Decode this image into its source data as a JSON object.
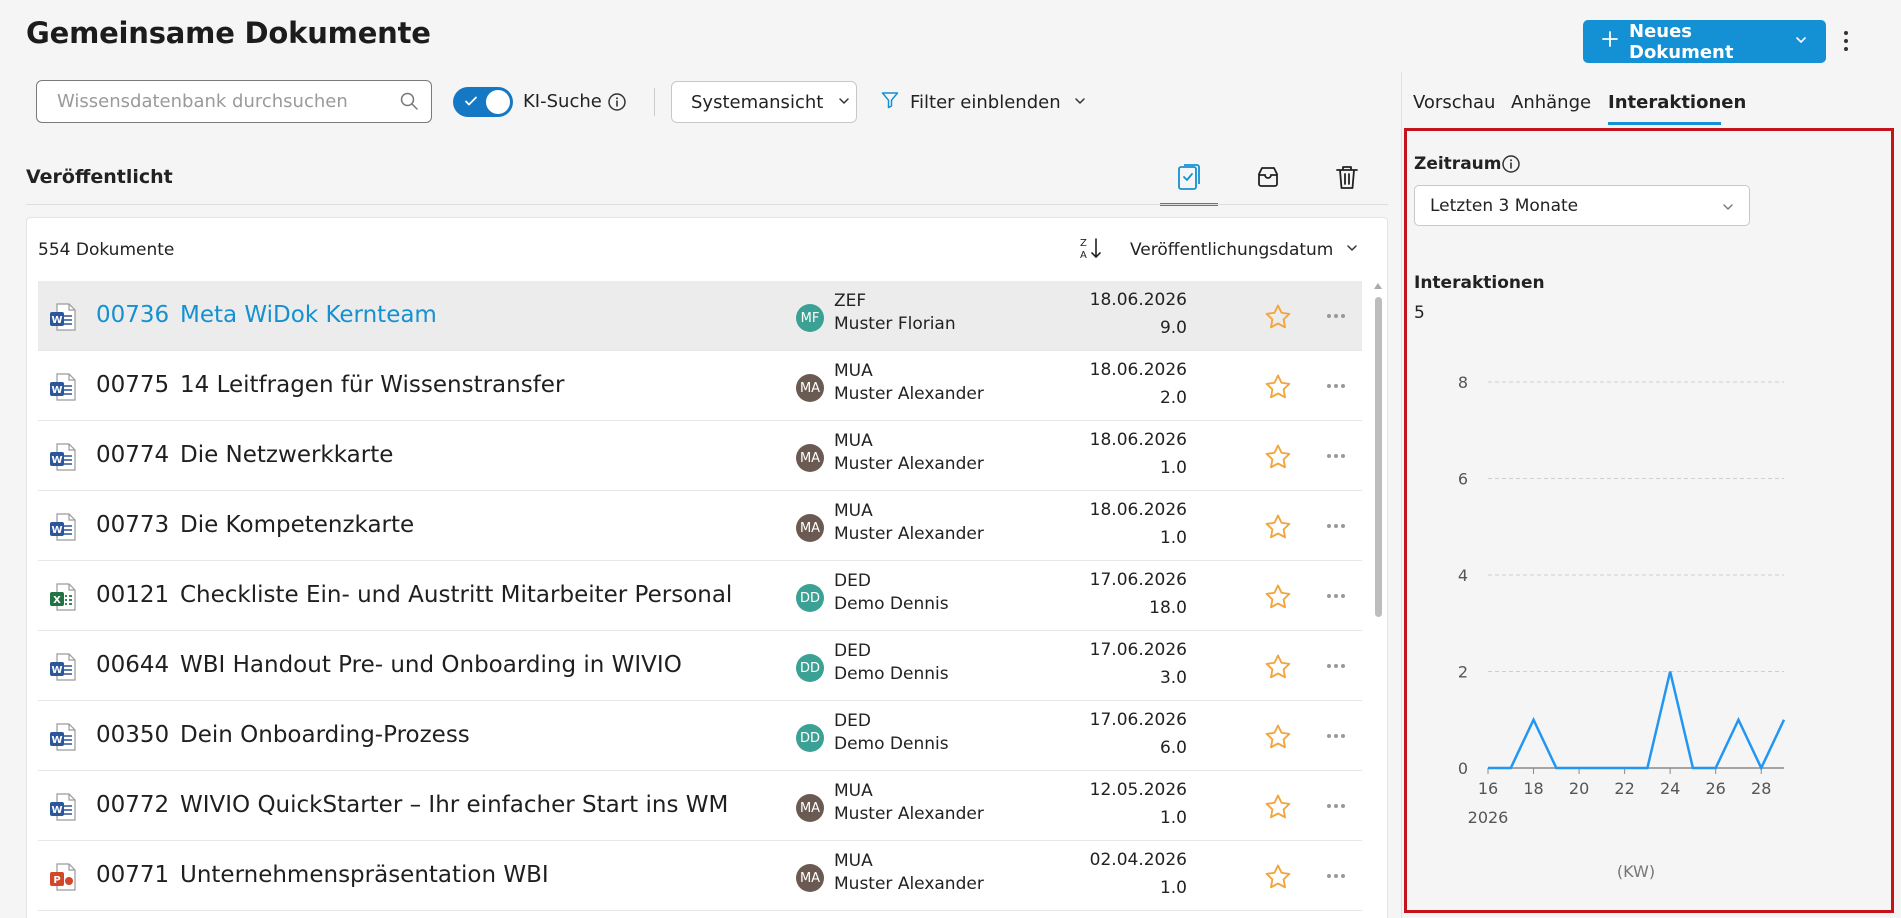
{
  "header": {
    "title": "Gemeinsame Dokumente",
    "new_document_label": "Neues Dokument"
  },
  "toolbar": {
    "search_placeholder": "Wissensdatenbank durchsuchen",
    "ai_search_label": "KI-Suche",
    "ai_search_enabled": true,
    "view_label": "Systemansicht",
    "filter_label": "Filter einblenden"
  },
  "section": {
    "title": "Veröffentlicht",
    "doc_count": "554 Dokumente",
    "sort_label": "Veröffentlichungsdatum"
  },
  "colors": {
    "accent": "#1490d4",
    "selection_border": "#c4131b",
    "star": "#f3a43b"
  },
  "documents": [
    {
      "type": "word",
      "number": "00736",
      "title": "Meta WiDok Kernteam",
      "initials": "MF",
      "avatar_color": "#3aa194",
      "code": "ZEF",
      "person": "Muster Florian",
      "date": "18.06.2026",
      "version": "9.0",
      "selected": true
    },
    {
      "type": "word",
      "number": "00775",
      "title": "14 Leitfragen für Wissenstransfer",
      "initials": "MA",
      "avatar_color": "#6b5a52",
      "code": "MUA",
      "person": "Muster Alexander",
      "date": "18.06.2026",
      "version": "2.0"
    },
    {
      "type": "word",
      "number": "00774",
      "title": "Die Netzwerkkarte",
      "initials": "MA",
      "avatar_color": "#6b5a52",
      "code": "MUA",
      "person": "Muster Alexander",
      "date": "18.06.2026",
      "version": "1.0"
    },
    {
      "type": "word",
      "number": "00773",
      "title": "Die Kompetenzkarte",
      "initials": "MA",
      "avatar_color": "#6b5a52",
      "code": "MUA",
      "person": "Muster Alexander",
      "date": "18.06.2026",
      "version": "1.0"
    },
    {
      "type": "excel",
      "number": "00121",
      "title": "Checkliste Ein- und Austritt Mitarbeiter Personal",
      "initials": "DD",
      "avatar_color": "#3aa194",
      "code": "DED",
      "person": "Demo Dennis",
      "date": "17.06.2026",
      "version": "18.0"
    },
    {
      "type": "word",
      "number": "00644",
      "title": "WBI Handout Pre- und Onboarding in WIVIO",
      "initials": "DD",
      "avatar_color": "#3aa194",
      "code": "DED",
      "person": "Demo Dennis",
      "date": "17.06.2026",
      "version": "3.0"
    },
    {
      "type": "word",
      "number": "00350",
      "title": "Dein Onboarding-Prozess",
      "initials": "DD",
      "avatar_color": "#3aa194",
      "code": "DED",
      "person": "Demo Dennis",
      "date": "17.06.2026",
      "version": "6.0"
    },
    {
      "type": "word",
      "number": "00772",
      "title": "WIVIO QuickStarter – Ihr einfacher Start ins WM",
      "initials": "MA",
      "avatar_color": "#6b5a52",
      "code": "MUA",
      "person": "Muster Alexander",
      "date": "12.05.2026",
      "version": "1.0"
    },
    {
      "type": "powerpoint",
      "number": "00771",
      "title": "Unternehmenspräsentation WBI",
      "initials": "MA",
      "avatar_color": "#6b5a52",
      "code": "MUA",
      "person": "Muster Alexander",
      "date": "02.04.2026",
      "version": "1.0"
    }
  ],
  "panel": {
    "tabs": [
      {
        "label": "Vorschau",
        "active": false
      },
      {
        "label": "Anhänge",
        "active": false
      },
      {
        "label": "Interaktionen",
        "active": true
      }
    ],
    "period_label": "Zeitraum",
    "period_value": "Letzten 3 Monate",
    "interactions_label": "Interaktionen",
    "interactions_value": "5"
  },
  "chart_data": {
    "type": "line",
    "x": [
      16,
      17,
      18,
      19,
      20,
      21,
      22,
      23,
      24,
      25,
      26,
      27,
      28,
      29
    ],
    "values": [
      0,
      0,
      1,
      0,
      0,
      0,
      0,
      0,
      2,
      0,
      0,
      1,
      0,
      1
    ],
    "x_ticks": [
      16,
      18,
      20,
      22,
      24,
      26,
      28
    ],
    "y_ticks": [
      0,
      2,
      4,
      6,
      8
    ],
    "ylim": [
      0,
      8
    ],
    "xlim": [
      16,
      29
    ],
    "year_label": "2026",
    "xlabel": "(KW)",
    "grid": true,
    "line_color": "#2196f3"
  }
}
